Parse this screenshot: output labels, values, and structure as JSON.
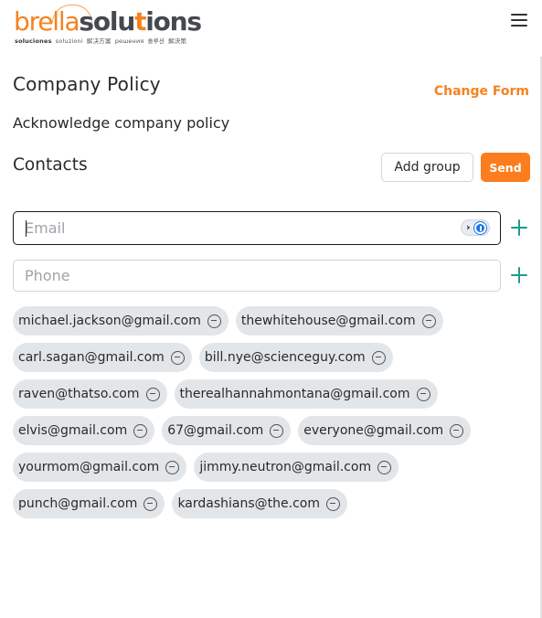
{
  "header": {
    "logo": {
      "part_a": "brella",
      "part_b": "solu",
      "part_c": "t",
      "part_d": "ions",
      "tagline": [
        "soluciones",
        "soluzioni",
        "解决方案",
        "решения",
        "솔루션",
        "解決策"
      ]
    },
    "menu_icon": "hamburger-menu-icon"
  },
  "policy": {
    "title": "Company Policy",
    "change_form_label": "Change Form",
    "description": "Acknowledge company policy"
  },
  "contacts": {
    "title": "Contacts",
    "add_group_label": "Add group",
    "send_label": "Send"
  },
  "inputs": {
    "email": {
      "placeholder": "Email",
      "value": ""
    },
    "phone": {
      "placeholder": "Phone",
      "value": ""
    }
  },
  "icons": {
    "add": "plus-icon",
    "remove": "minus-circle-icon",
    "password_manager": "password-manager-icon"
  },
  "chip_rows": [
    [
      "michael.jackson@gmail.com",
      "thewhitehouse@gmail.com"
    ],
    [
      "carl.sagan@gmail.com",
      "bill.nye@scienceguy.com"
    ],
    [
      "raven@thatso.com",
      "therealhannahmontana@gmail.com"
    ],
    [
      "elvis@gmail.com",
      "67@gmail.com",
      "everyone@gmail.com"
    ],
    [
      "yourmom@gmail.com",
      "jimmy.neutron@gmail.com"
    ],
    [
      "punch@gmail.com",
      "kardashians@the.com"
    ]
  ],
  "colors": {
    "brand_orange": "#f5821f",
    "send_button": "#fb7d1e",
    "add_icon_teal": "#1e9c8c",
    "chip_background": "#e3e6e9"
  }
}
